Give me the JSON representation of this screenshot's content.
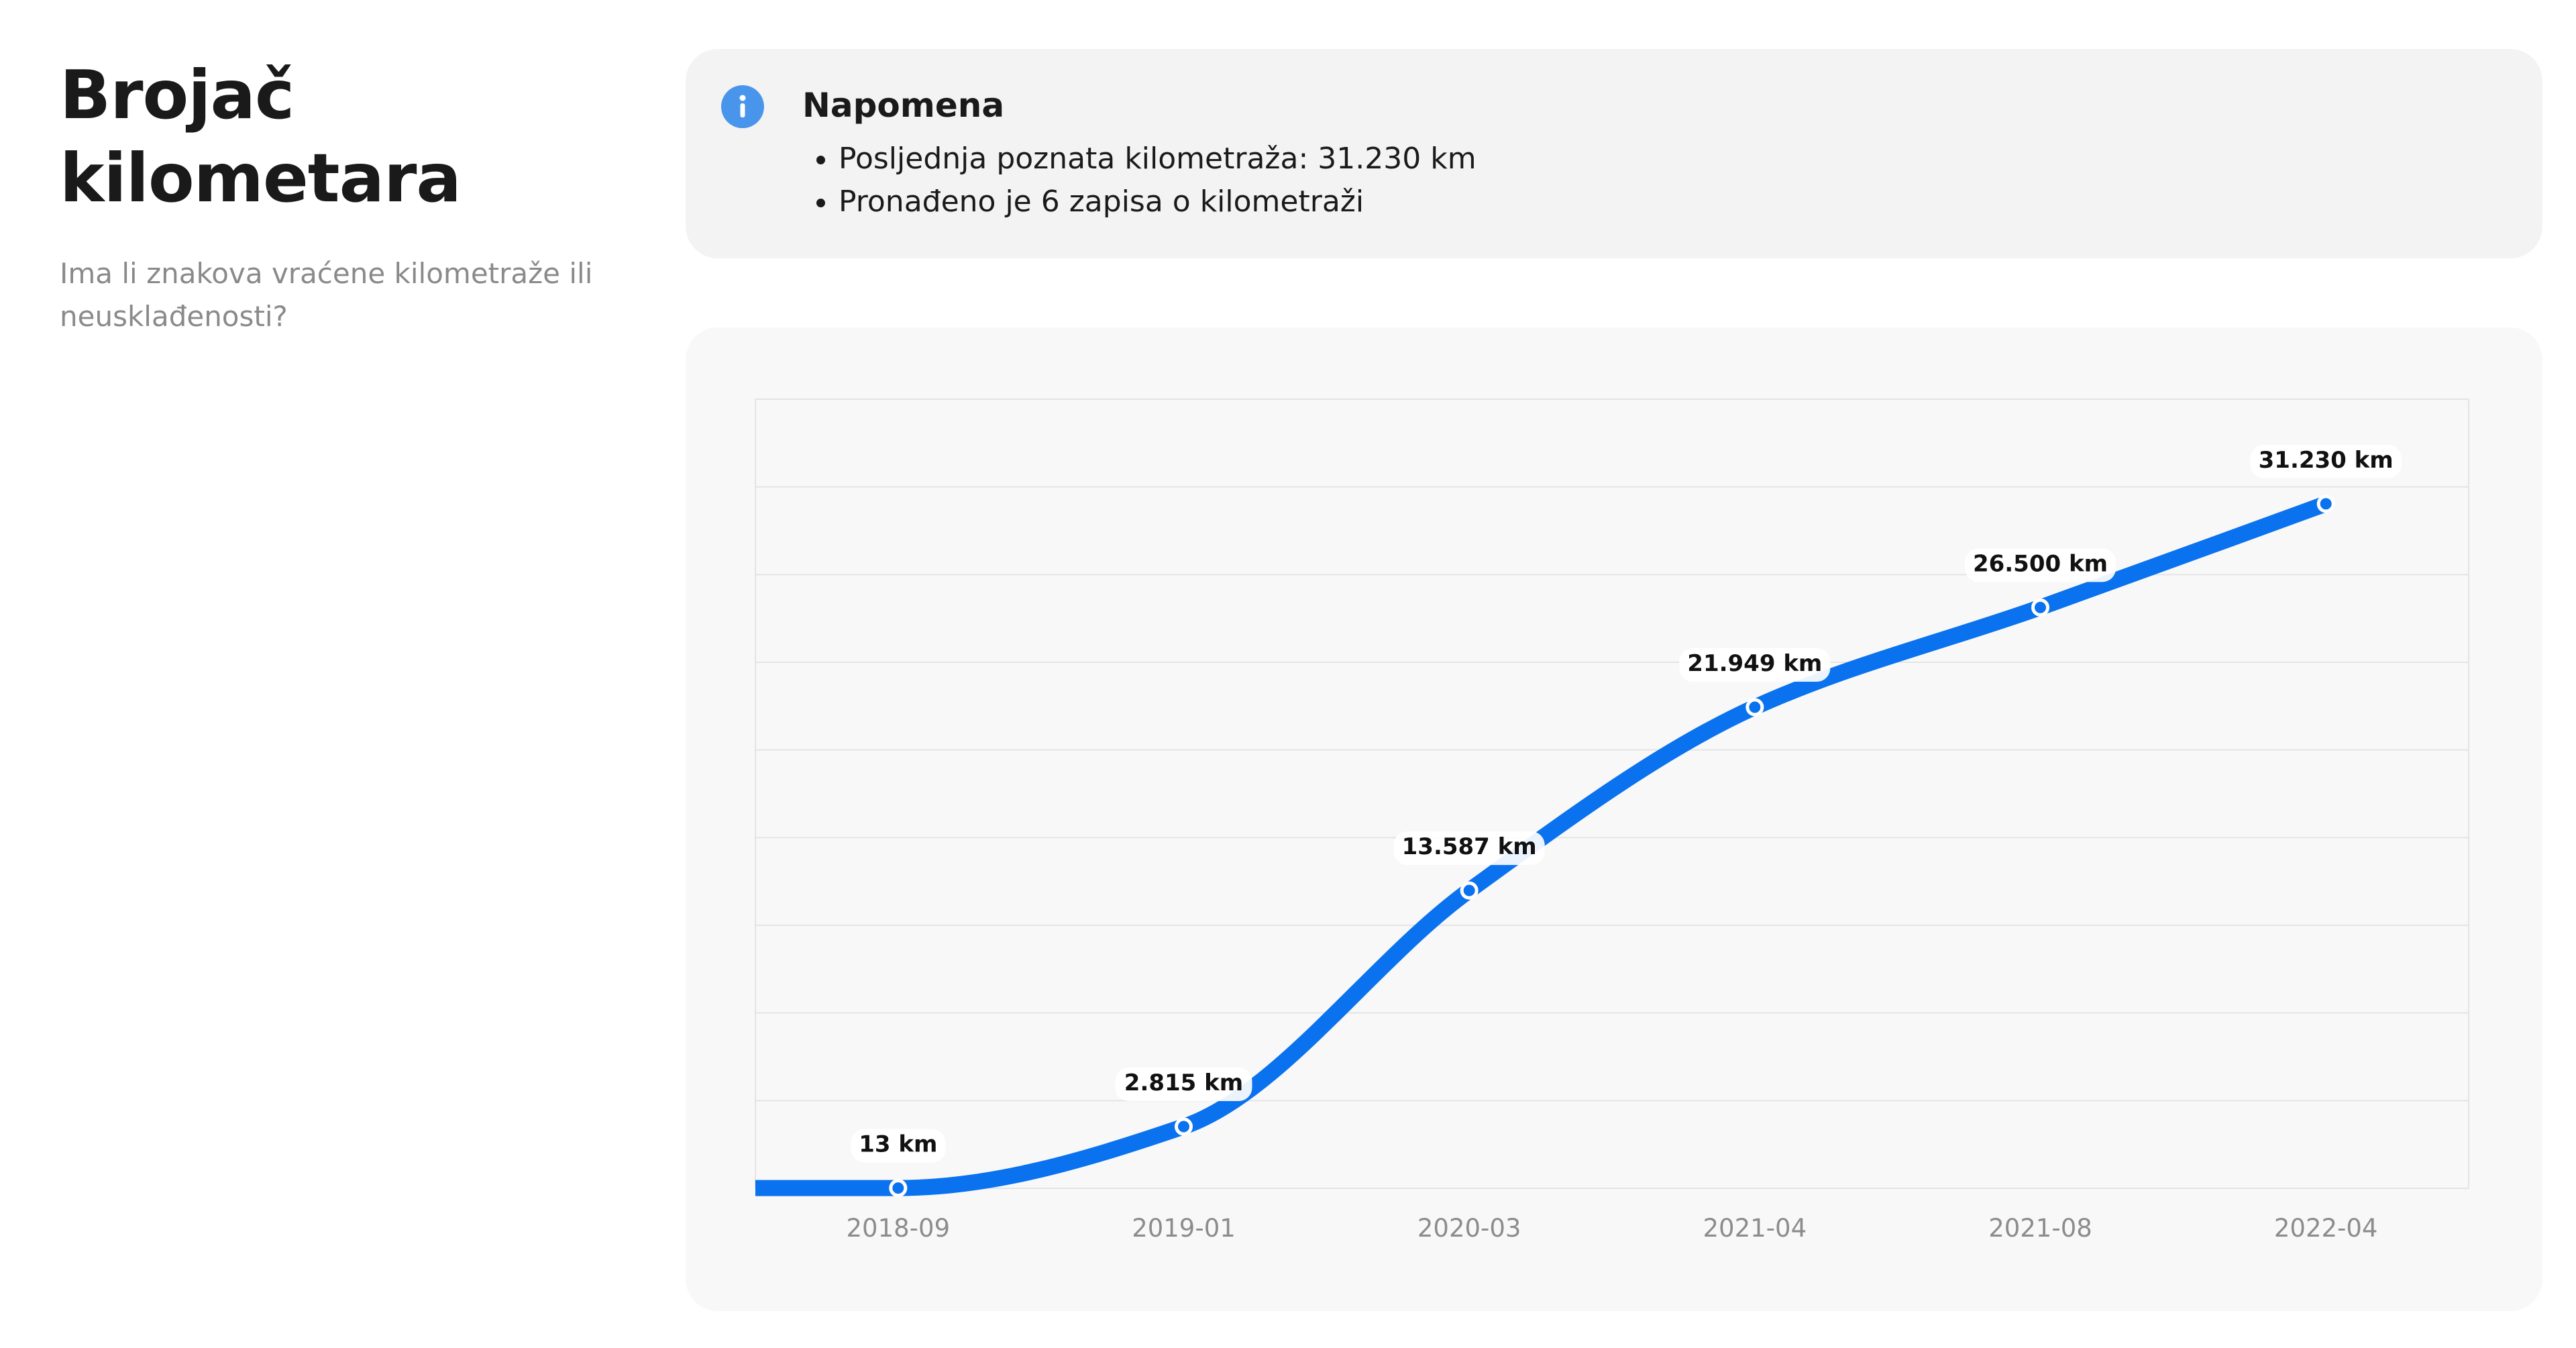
{
  "header": {
    "title": "Brojač kilometara",
    "subtitle": "Ima li znakova vraćene kilometraže ili neusklađenosti?"
  },
  "note": {
    "icon": "info-icon",
    "title": "Napomena",
    "items": [
      "Posljednja poznata kilometraža: 31.230 km",
      "Pronađeno je 6 zapisa o kilometraži"
    ]
  },
  "colors": {
    "line": "#0a72ee",
    "info_icon": "#4a95ec",
    "grid": "#e4e4e4"
  },
  "chart_data": {
    "type": "line",
    "categories": [
      "2018-09",
      "2019-01",
      "2020-03",
      "2021-04",
      "2021-08",
      "2022-04"
    ],
    "values": [
      13,
      2815,
      13587,
      21949,
      26500,
      31230
    ],
    "data_labels": [
      "13 km",
      "2.815 km",
      "13.587 km",
      "21.949 km",
      "26.500 km",
      "31.230 km"
    ],
    "title": "",
    "xlabel": "",
    "ylabel": "",
    "unit": "km",
    "ylim": [
      0,
      36000
    ],
    "grid": true,
    "legend": "none",
    "smooth": true
  }
}
